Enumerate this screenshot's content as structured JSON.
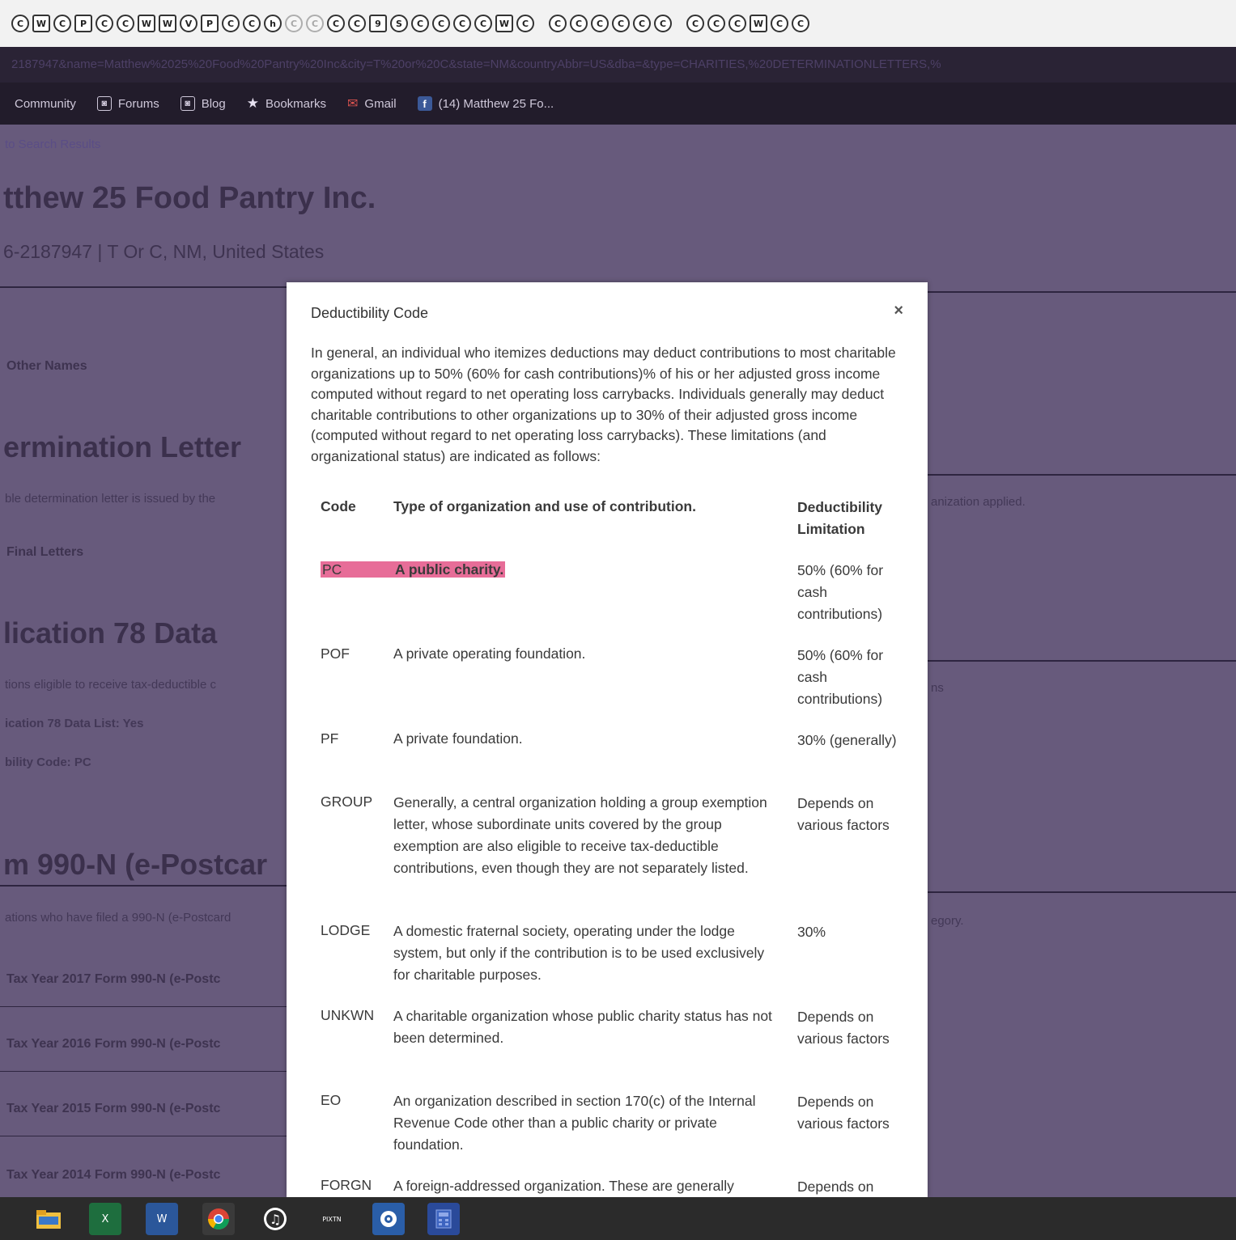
{
  "browser": {
    "tab_icons": [
      "C",
      "W",
      "C",
      "P",
      "C",
      "C",
      "W",
      "W",
      "V",
      "P",
      "C",
      "C",
      "h",
      "C",
      "C",
      "C",
      "C",
      "9",
      "S",
      "C",
      "C",
      "C",
      "C",
      "W",
      "C",
      "C",
      "C",
      "C",
      "C",
      "C",
      "C",
      "C",
      "C",
      "C",
      "W",
      "C",
      "C"
    ],
    "url": "2187947&name=Matthew%2025%20Food%20Pantry%20Inc&city=T%20or%20C&state=NM&countryAbbr=US&dba=&type=CHARITIES,%20DETERMINATIONLETTERS,%",
    "bookmarks": {
      "community": "Community",
      "forums": "Forums",
      "blog": "Blog",
      "bookmarks": "Bookmarks",
      "gmail": "Gmail",
      "facebook": "(14) Matthew 25 Fo..."
    }
  },
  "background": {
    "back_link": "to Search Results",
    "org_name": "tthew 25 Food Pantry Inc.",
    "org_sub": "6-2187947 | T Or C, NM, United States",
    "other_names": "Other Names",
    "determination_heading": "ermination Letter",
    "determination_desc": "ble determination letter is issued by the",
    "determination_desc_right": "anization applied.",
    "final_letters": "Final Letters",
    "pub78_heading": "lication 78 Data",
    "pub78_desc": "tions eligible to receive tax-deductible c",
    "pub78_desc_right": "ns",
    "pub78_list": "ication 78 Data List: Yes",
    "deduct_code": "bility Code: PC",
    "epostcard_heading": "m 990-N (e-Postcar",
    "epostcard_desc": "ations who have filed a 990-N (e-Postcard",
    "epostcard_desc_right": "egory.",
    "tax_years": [
      "Tax Year 2017 Form 990-N (e-Postc",
      "Tax Year 2016 Form 990-N (e-Postc",
      "Tax Year 2015 Form 990-N (e-Postc",
      "Tax Year 2014 Form 990-N (e-Postc"
    ]
  },
  "modal": {
    "title": "Deductibility Code",
    "close": "×",
    "intro": "In general, an individual who itemizes deductions may deduct contributions to most charitable organizations up to 50% (60% for cash contributions)% of his or her adjusted gross income computed without regard to net operating loss carrybacks. Individuals generally may deduct charitable contributions to other organizations up to 30% of their adjusted gross income (computed without regard to net operating loss carrybacks). These limitations (and organizational status) are indicated as follows:",
    "headers": {
      "code": "Code",
      "type": "Type of organization and use of contribution.",
      "limit": "Deductibility Limitation"
    },
    "rows": [
      {
        "code": "PC",
        "type": "A public charity.",
        "limit": "50% (60% for cash contributions)"
      },
      {
        "code": "POF",
        "type": "A private operating foundation.",
        "limit": "50% (60% for cash contributions)"
      },
      {
        "code": "PF",
        "type": "A private foundation.",
        "limit": "30% (generally)"
      },
      {
        "code": "GROUP",
        "type": "Generally, a central organization holding a group exemption letter, whose subordinate units covered by the group exemption are also eligible to receive tax-deductible contributions, even though they are not separately listed.",
        "limit": "Depends on various factors"
      },
      {
        "code": "LODGE",
        "type": "A domestic fraternal society, operating under the lodge system, but only if the contribution is to be used exclusively for charitable purposes.",
        "limit": "30%"
      },
      {
        "code": "UNKWN",
        "type": "A charitable organization whose public charity status has not been determined.",
        "limit": "Depends on various factors"
      },
      {
        "code": "EO",
        "type": "An organization described in section 170(c) of the Internal Revenue Code other than a public charity or private foundation.",
        "limit": "Depends on various factors"
      },
      {
        "code": "FORGN",
        "type": "A foreign-addressed organization. These are generally",
        "limit": "Depends on"
      }
    ]
  },
  "taskbar": {
    "items": [
      "file-explorer-icon",
      "excel-icon",
      "word-icon",
      "chrome-icon",
      "itunes-icon",
      "onenote-icon",
      "settings-icon",
      "calculator-icon"
    ],
    "labels": {
      "excel": "X",
      "word": "W",
      "onenote": "ΡΙΧΤΝ"
    }
  }
}
